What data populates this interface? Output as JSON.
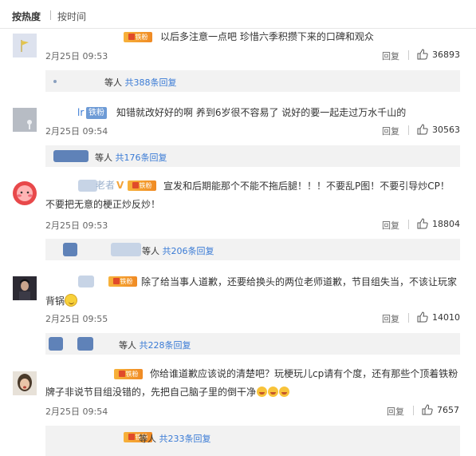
{
  "sort": {
    "hot": "按热度",
    "time": "按时间"
  },
  "badge_label": "铁粉",
  "comments": [
    {
      "text": "以后多注意一点吧 珍惜六季积攒下来的口碑和观众",
      "time": "2月25日 09:53",
      "reply_label": "回复",
      "likes": "36893",
      "replies_prefix": "等人",
      "replies_count": "共388条回复"
    },
    {
      "name_fragment": "lr",
      "text": "知错就改好好的啊 养到6岁很不容易了 说好的要一起走过万水千山的",
      "time": "2月25日 09:54",
      "reply_label": "回复",
      "likes": "30563",
      "replies_prefix": "等人",
      "replies_count": "共176条回复"
    },
    {
      "name_fragment": "老者",
      "text_line1": "宣发和后期能那个不能不拖后腿！！！不要乱P图！不要引导炒CP！",
      "text_line2": "不要把无意的梗正炒反炒！",
      "time": "2月25日 09:53",
      "reply_label": "回复",
      "likes": "18804",
      "replies_prefix": "等人",
      "replies_count": "共206条回复"
    },
    {
      "text_line1": "除了给当事人道歉，还要给换头的两位老师道歉，节目组失当，不该让玩家",
      "text_line2": "背锅",
      "time": "2月25日 09:55",
      "reply_label": "回复",
      "likes": "14010",
      "replies_prefix": "等人",
      "replies_count": "共228条回复"
    },
    {
      "text_line1": "你给谁道歉应该说的清楚吧？玩梗玩儿cp请有个度，还有那些个顶着铁粉",
      "text_line2": "牌子非说节目组没错的，先把自己脑子里的倒干净",
      "time": "2月25日 09:54",
      "reply_label": "回复",
      "likes": "7657",
      "replies_prefix": "等人",
      "replies_count": "共233条回复"
    }
  ],
  "colors": {
    "link": "#3a7bd5",
    "badge": "#f39a2d",
    "fan_badge": "#6e9bd6",
    "reply_bg": "#f2f2f2"
  }
}
